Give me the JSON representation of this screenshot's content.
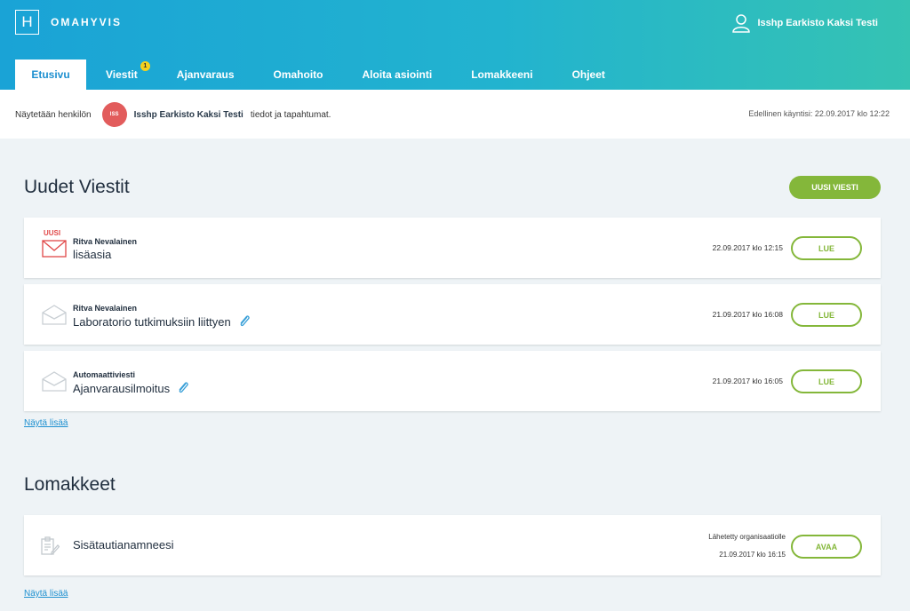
{
  "header": {
    "logo_letter": "H",
    "brand": "OMAHYVIS",
    "user_name": "Isshp Earkisto Kaksi Testi"
  },
  "nav": {
    "tabs": [
      {
        "label": "Etusivu",
        "active": true
      },
      {
        "label": "Viestit",
        "badge": "1"
      },
      {
        "label": "Ajanvaraus"
      },
      {
        "label": "Omahoito"
      },
      {
        "label": "Aloita asiointi"
      },
      {
        "label": "Lomakkeeni"
      },
      {
        "label": "Ohjeet"
      }
    ]
  },
  "infobar": {
    "prefix": "Näytetään henkilön",
    "avatar_initials": "ISS",
    "person": "Isshp Earkisto Kaksi Testi",
    "suffix": "tiedot ja tapahtumat.",
    "last_visit": "Edellinen käyntisi: 22.09.2017 klo 12:22"
  },
  "messages": {
    "title": "Uudet Viestit",
    "new_button": "UUSI VIESTI",
    "items": [
      {
        "new_label": "UUSI",
        "sender": "Ritva Nevalainen",
        "subject": "lisäasia",
        "date": "22.09.2017 klo 12:15",
        "action": "LUE"
      },
      {
        "sender": "Ritva Nevalainen",
        "subject": "Laboratorio tutkimuksiin liittyen",
        "date": "21.09.2017 klo 16:08",
        "action": "LUE"
      },
      {
        "sender": "Automaattiviesti",
        "subject": "Ajanvarausilmoitus",
        "date": "21.09.2017 klo 16:05",
        "action": "LUE"
      }
    ],
    "more": "Näytä lisää"
  },
  "forms": {
    "title": "Lomakkeet",
    "items": [
      {
        "name": "Sisätautianamneesi",
        "status": "Lähetetty organisaatiolle",
        "date": "21.09.2017 klo 16:15",
        "action": "AVAA"
      }
    ],
    "more": "Näytä lisää"
  },
  "colors": {
    "header_start": "#1aa3d6",
    "header_end": "#35c3b3",
    "accent_green": "#84b73a",
    "new_red": "#e04848",
    "link_blue": "#1e90d0"
  }
}
